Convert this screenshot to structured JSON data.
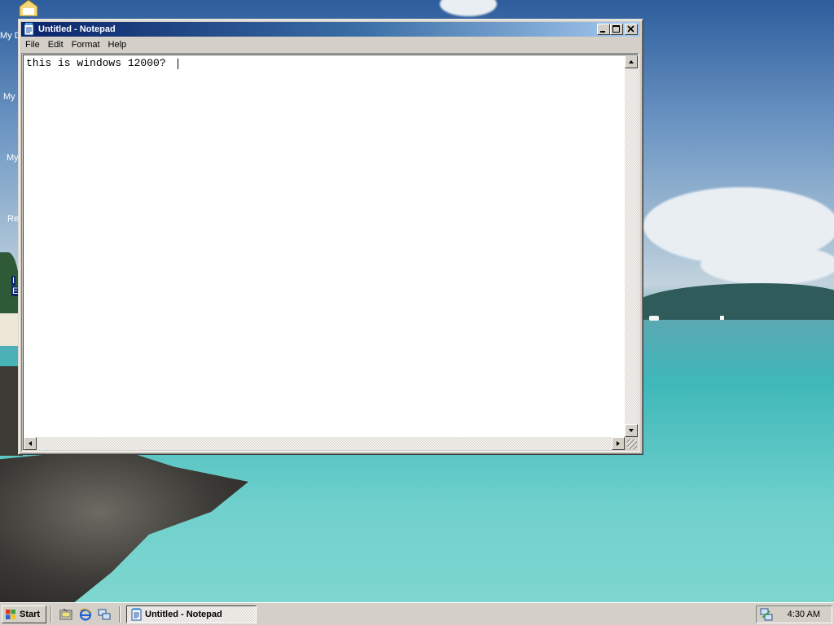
{
  "desktop": {
    "icons": [
      {
        "label": "My D"
      },
      {
        "label": "My"
      },
      {
        "label": "My"
      },
      {
        "label": "Re"
      },
      {
        "label": "I"
      },
      {
        "label": "E"
      }
    ]
  },
  "window": {
    "title": "Untitled - Notepad",
    "menu": [
      "File",
      "Edit",
      "Format",
      "Help"
    ],
    "content": "this is windows 12000? "
  },
  "taskbar": {
    "start_label": "Start",
    "task_label": "Untitled - Notepad",
    "clock": "4:30 AM",
    "quicklaunch": [
      "show-desktop-icon",
      "internet-explorer-icon",
      "network-icon"
    ]
  },
  "colors": {
    "titlebar_start": "#0a246a",
    "titlebar_end": "#a6caf0",
    "chrome": "#d4d0c8"
  }
}
